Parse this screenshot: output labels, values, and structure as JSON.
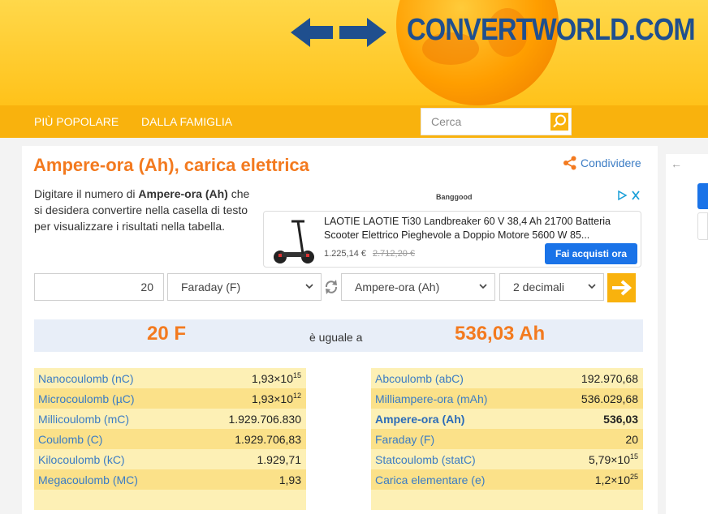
{
  "header": {
    "logo_text": "CONVERTWORLD.COM"
  },
  "nav": {
    "items": [
      "PIÙ POPOLARE",
      "DALLA FAMIGLIA"
    ],
    "search_placeholder": "Cerca"
  },
  "page": {
    "title": "Ampere-ora (Ah), carica elettrica",
    "share_label": "Condividere",
    "intro_before": "Digitare il numero di ",
    "intro_bold": "Ampere-ora (Ah)",
    "intro_after": " che si desidera convertire nella casella di testo per visualizzare i risultati nella tabella."
  },
  "ad": {
    "brand": "Banggood",
    "title": "LAOTIE LAOTIE Ti30 Landbreaker 60 V 38,4 Ah 21700 Batteria Scooter Elettrico Pieghevole a Doppio Motore 5600 W 85...",
    "price": "1.225,14 €",
    "old_price": "2.712,20 €",
    "button": "Fai acquisti ora"
  },
  "converter": {
    "amount": "20",
    "from_unit": "Faraday (F)",
    "to_unit": "Ampere-ora (Ah)",
    "decimals": "2 decimali"
  },
  "result": {
    "left": "20 F",
    "equals": "è uguale a",
    "right": "536,03 Ah"
  },
  "table_left": [
    {
      "name": "Nanocoulomb (nC)",
      "base": "1,93×10",
      "exp": "15"
    },
    {
      "name": "Microcoulomb (µC)",
      "base": "1,93×10",
      "exp": "12"
    },
    {
      "name": "Millicoulomb (mC)",
      "base": "1.929.706.830",
      "exp": ""
    },
    {
      "name": "Coulomb (C)",
      "base": "1.929.706,83",
      "exp": ""
    },
    {
      "name": "Kilocoulomb (kC)",
      "base": "1.929,71",
      "exp": ""
    },
    {
      "name": "Megacoulomb (MC)",
      "base": "1,93",
      "exp": ""
    }
  ],
  "table_right": [
    {
      "name": "Abcoulomb (abC)",
      "base": "192.970,68",
      "exp": ""
    },
    {
      "name": "Milliampere-ora (mAh)",
      "base": "536.029,68",
      "exp": ""
    },
    {
      "name": "Ampere-ora (Ah)",
      "base": "536,03",
      "exp": "",
      "active": true
    },
    {
      "name": "Faraday (F)",
      "base": "20",
      "exp": ""
    },
    {
      "name": "Statcoulomb (statC)",
      "base": "5,79×10",
      "exp": "15"
    },
    {
      "name": "Carica elementare (e)",
      "base": "1,2×10",
      "exp": "25"
    }
  ],
  "colors": {
    "accent_orange": "#f37a1f",
    "nav_yellow": "#f9b20d",
    "link_blue": "#3b7cc4",
    "logo_blue": "#1f4f8e"
  }
}
